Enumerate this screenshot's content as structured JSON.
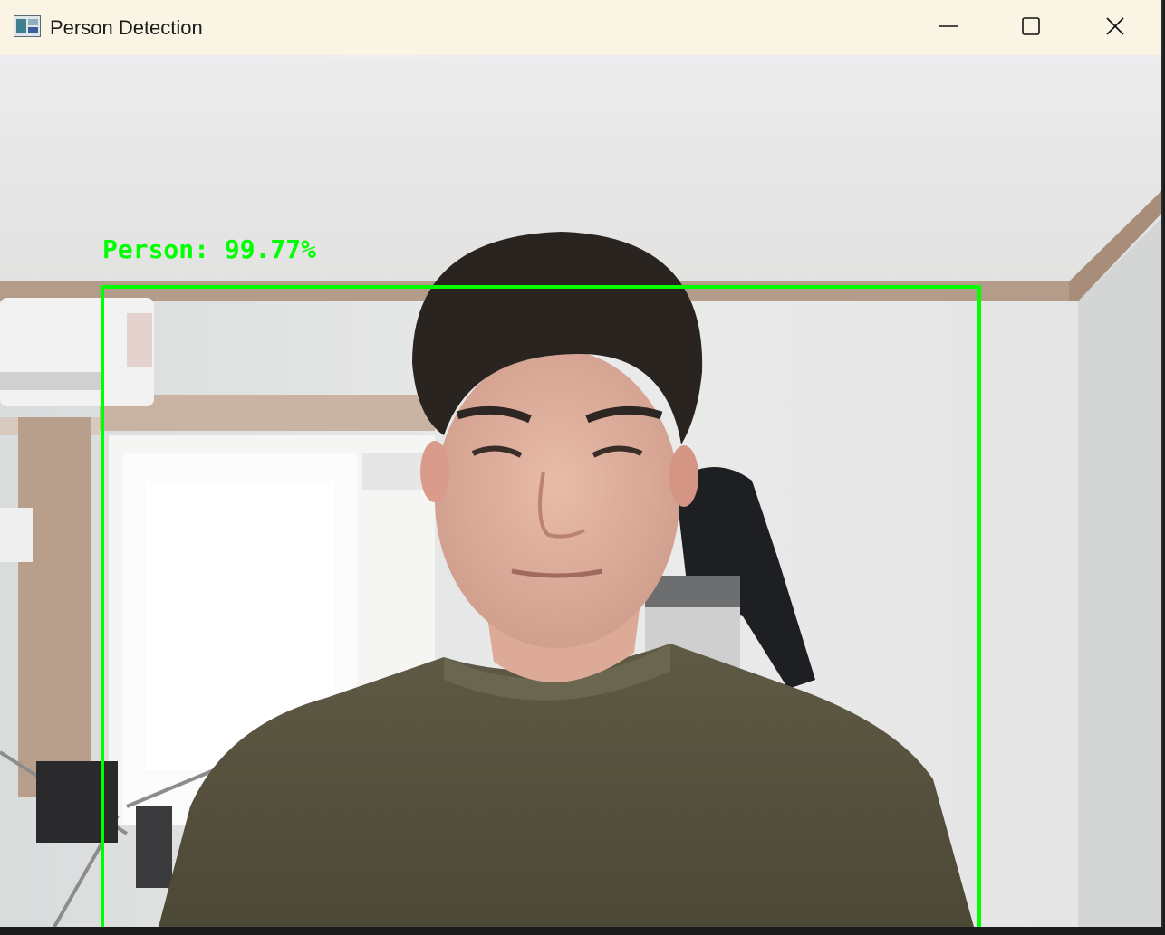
{
  "window": {
    "title": "Person Detection",
    "icon": "opencv-window-icon",
    "controls": {
      "minimize_icon": "minimize-icon",
      "maximize_icon": "maximize-icon",
      "close_icon": "close-icon"
    }
  },
  "detection": {
    "label": "Person: 99.77%",
    "box_color": "#00ff00"
  }
}
